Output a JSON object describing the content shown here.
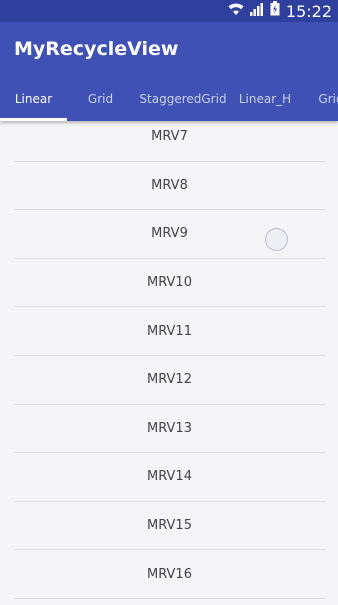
{
  "status_bar": {
    "time": "15:22",
    "icons": [
      "wifi-icon",
      "signal-icon",
      "battery-icon"
    ]
  },
  "app_bar": {
    "title": "MyRecycleView"
  },
  "tabs": [
    {
      "label": "Linear",
      "active": true
    },
    {
      "label": "Grid",
      "active": false
    },
    {
      "label": "StaggeredGrid",
      "active": false
    },
    {
      "label": "Linear_H",
      "active": false
    },
    {
      "label": "Grid",
      "active": false
    }
  ],
  "list": {
    "items": [
      "MRV7",
      "MRV8",
      "MRV9",
      "MRV10",
      "MRV11",
      "MRV12",
      "MRV13",
      "MRV14",
      "MRV15",
      "MRV16"
    ]
  },
  "colors": {
    "primary": "#3f51b5",
    "primary_dark": "#2f3f9e",
    "background": "#f5f5f7"
  }
}
